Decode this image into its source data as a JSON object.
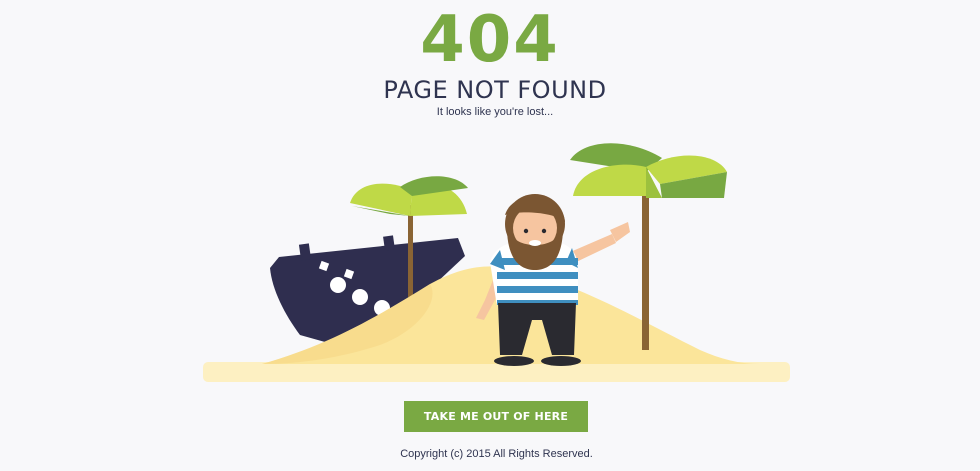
{
  "error": {
    "code": "404",
    "title": "PAGE NOT FOUND",
    "subtitle": "It looks like you're lost..."
  },
  "action": {
    "button_label": "TAKE ME OUT OF HERE"
  },
  "footer": {
    "copyright": "Copyright (c) 2015 All Rights Reserved."
  },
  "colors": {
    "accent": "#7aa943",
    "heading": "#2f3450",
    "sand": "#fbe59a",
    "ship": "#2f2e4f",
    "palm_leaf_light": "#bfd947",
    "palm_leaf_dark": "#78a842",
    "shirt_stripe": "#3f8fc0"
  },
  "illustration": {
    "icons": [
      "shipwreck-icon",
      "palm-tree-icon",
      "castaway-icon",
      "sand-island-icon"
    ]
  }
}
